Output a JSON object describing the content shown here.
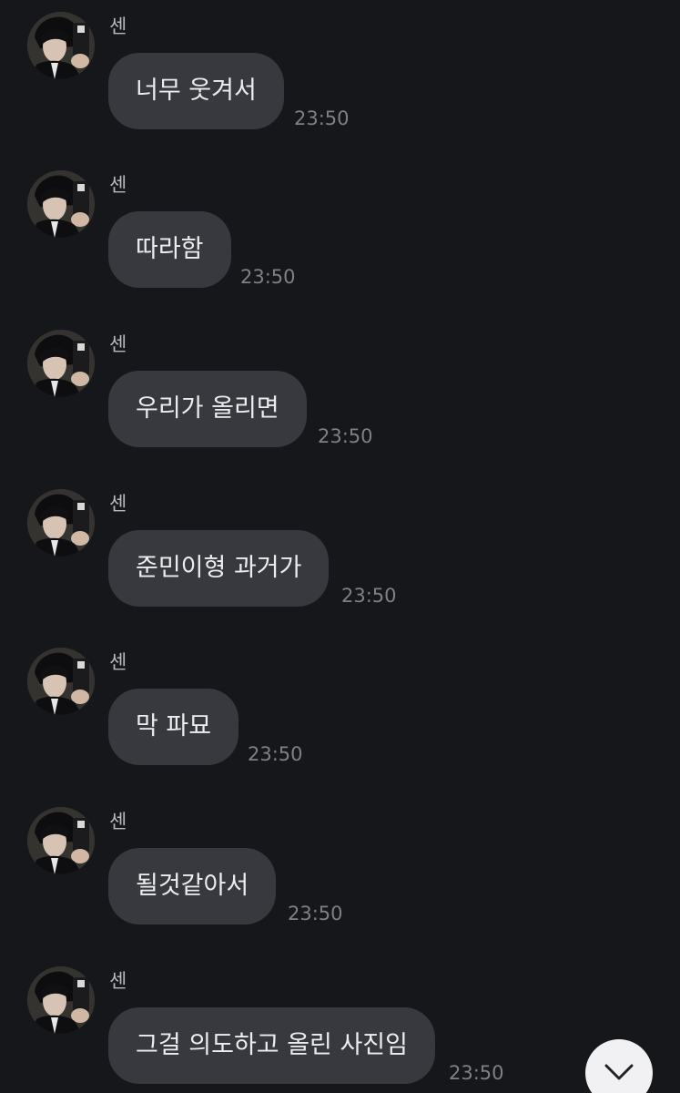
{
  "messages": [
    {
      "sender": "센",
      "text": "너무 웃겨서",
      "time": "23:50"
    },
    {
      "sender": "센",
      "text": "따라함",
      "time": "23:50"
    },
    {
      "sender": "센",
      "text": "우리가 올리면",
      "time": "23:50"
    },
    {
      "sender": "센",
      "text": "준민이형 과거가",
      "time": "23:50"
    },
    {
      "sender": "센",
      "text": "막 파묘",
      "time": "23:50"
    },
    {
      "sender": "센",
      "text": "될것같아서",
      "time": "23:50"
    },
    {
      "sender": "센",
      "text": "그걸 의도하고 올린 사진임",
      "time": "23:50"
    }
  ],
  "controls": {
    "scroll_down_icon": "chevron-down-icon"
  },
  "colors": {
    "background": "#16171b",
    "bubble": "#38393e",
    "text": "#ecedef",
    "timestamp": "#7f8086",
    "sender": "#b9b9bd"
  }
}
